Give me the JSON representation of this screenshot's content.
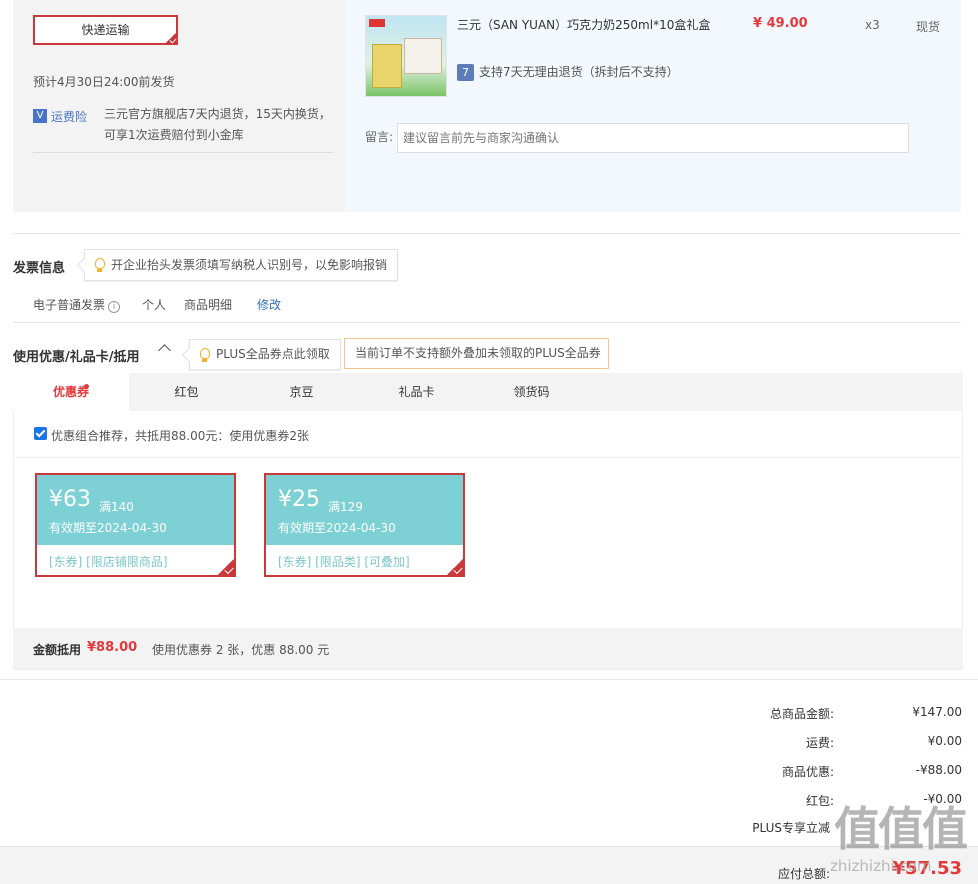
{
  "shipping": {
    "method_label": "快递运输",
    "eta": "预计4月30日24:00前发货",
    "insurance_icon": "V",
    "insurance_label": "运费险",
    "insurance_desc": "三元官方旗舰店7天内退货，15天内换货，可享1次运费赔付到小金库"
  },
  "product": {
    "title": "三元（SAN YUAN）巧克力奶250ml*10盒礼盒",
    "price": "¥ 49.00",
    "qty": "x3",
    "stock": "现货",
    "return_icon": "7",
    "return_policy": "支持7天无理由退货（拆封后不支持）",
    "message_label": "留言:",
    "message_placeholder": "建议留言前先与商家沟通确认"
  },
  "invoice": {
    "title": "发票信息",
    "tip": "开企业抬头发票须填写纳税人识别号，以免影响报销",
    "type": "电子普通发票",
    "info_icon": "i",
    "header": "个人",
    "content": "商品明细",
    "edit_label": "修改"
  },
  "discount": {
    "title": "使用优惠/礼品卡/抵用",
    "plus_tip": "PLUS全品券点此领取",
    "notice": "当前订单不支持额外叠加未领取的PLUS全品券",
    "tabs": [
      "优惠券",
      "红包",
      "京豆",
      "礼品卡",
      "领货码"
    ],
    "combo_text": "优惠组合推荐，共抵用88.00元：使用优惠券2张",
    "coupons": [
      {
        "amount": "¥63",
        "condition": "满140",
        "valid": "有效期至2024-04-30",
        "tags": "[东券]  [限店铺限商品]"
      },
      {
        "amount": "¥25",
        "condition": "满129",
        "valid": "有效期至2024-04-30",
        "tags": "[东券]  [限品类]  [可叠加]"
      }
    ],
    "summary_label": "金额抵用",
    "summary_amount": "¥88.00",
    "summary_desc": "使用优惠券 2 张，优惠 88.00 元"
  },
  "totals": {
    "rows": [
      {
        "label": "总商品金额:",
        "value": "¥147.00"
      },
      {
        "label": "运费:",
        "value": "¥0.00"
      },
      {
        "label": "商品优惠:",
        "value": "-¥88.00"
      },
      {
        "label": "红包:",
        "value": "-¥0.00"
      },
      {
        "label": "PLUS专享立减",
        "value": ""
      }
    ],
    "pay_label": "应付总额:",
    "pay_value": "¥57.53"
  },
  "watermark": {
    "logo": "值值值",
    "url": "zhizhizhi.com"
  }
}
